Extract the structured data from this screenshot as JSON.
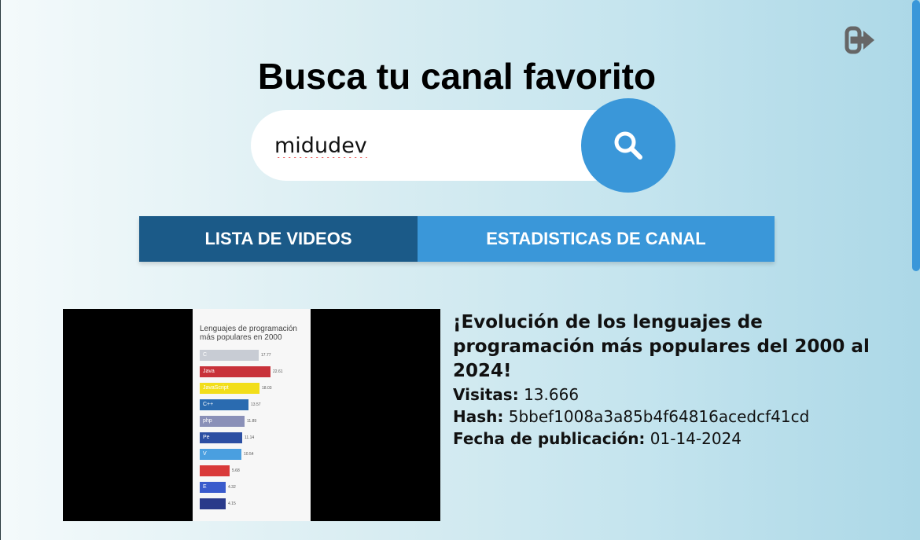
{
  "header": {
    "title": "Busca tu canal favorito",
    "logout_icon": "sign-out-icon"
  },
  "search": {
    "value": "midudev",
    "button_icon": "search-icon"
  },
  "tabs": [
    {
      "label": "LISTA DE VIDEOS",
      "active": true
    },
    {
      "label": "ESTADISTICAS DE CANAL",
      "active": false
    }
  ],
  "videos": [
    {
      "title": "¡Evolución de los lenguajes de programación más populares del 2000 al 2024!",
      "visits_label": "Visitas:",
      "visits": "13.666",
      "hash_label": "Hash:",
      "hash": "5bbef1008a3a85b4f64816acedcf41cd",
      "date_label": "Fecha de publicación:",
      "date": "01-14-2024",
      "thumbnail": {
        "title": "Lenguajes de programación más populares en 2000",
        "bars": [
          {
            "label": "C",
            "value": "17.77",
            "color": "#c8ccd4"
          },
          {
            "label": "Java",
            "value": "22.61",
            "color": "#c8323a"
          },
          {
            "label": "JavaScript",
            "value": "18.03",
            "color": "#f2de1a"
          },
          {
            "label": "C++",
            "value": "13.57",
            "color": "#2a6bb0"
          },
          {
            "label": "php",
            "value": "11.89",
            "color": "#8a90b8"
          },
          {
            "label": "Pe",
            "value": "11.14",
            "color": "#2c4fa3"
          },
          {
            "label": "V",
            "value": "10.54",
            "color": "#4a9fe0"
          },
          {
            "label": "",
            "value": "5.68",
            "color": "#d93a3a"
          },
          {
            "label": "E",
            "value": "4.32",
            "color": "#3a5bcc"
          },
          {
            "label": "",
            "value": "4.15",
            "color": "#2a3a8a"
          }
        ]
      }
    }
  ],
  "colors": {
    "accent": "#3a97d9",
    "tab_active": "#1b5a88"
  }
}
